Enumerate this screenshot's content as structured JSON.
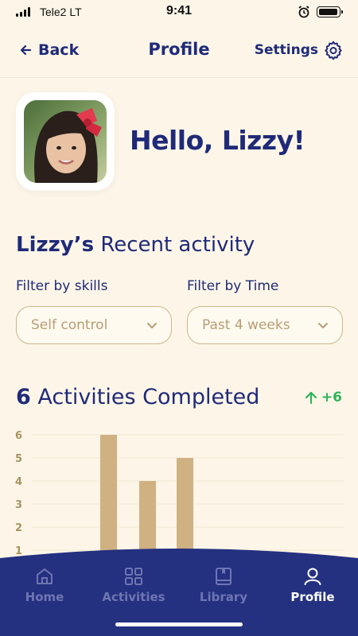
{
  "status": {
    "carrier": "Tele2 LT",
    "time": "9:41"
  },
  "nav": {
    "back_label": "Back",
    "title": "Profile",
    "settings_label": "Settings"
  },
  "profile": {
    "greeting": "Hello, Lizzy!"
  },
  "recent": {
    "name": "Lizzy’s",
    "label": "Recent activity"
  },
  "filters": {
    "skills": {
      "label": "Filter by skills",
      "value": "Self control"
    },
    "time": {
      "label": "Filter by Time",
      "value": "Past 4 weeks"
    }
  },
  "summary": {
    "count": "6",
    "label": "Activities Completed",
    "delta": "+6"
  },
  "chart_data": {
    "type": "bar",
    "y_ticks": [
      "6",
      "5",
      "4",
      "3",
      "2",
      "1"
    ],
    "ylim": [
      1,
      6
    ],
    "values": [
      6,
      4,
      5
    ],
    "bar_color": "#cfb182",
    "grid": true
  },
  "tabs": [
    {
      "label": "Home",
      "icon": "home-icon",
      "active": false
    },
    {
      "label": "Activities",
      "icon": "grid-icon",
      "active": false
    },
    {
      "label": "Library",
      "icon": "book-icon",
      "active": false
    },
    {
      "label": "Profile",
      "icon": "user-icon",
      "active": true
    }
  ],
  "colors": {
    "primary": "#1f2a78",
    "background": "#fdf6e8",
    "accent": "#cfb182",
    "positive": "#2fb35a"
  }
}
